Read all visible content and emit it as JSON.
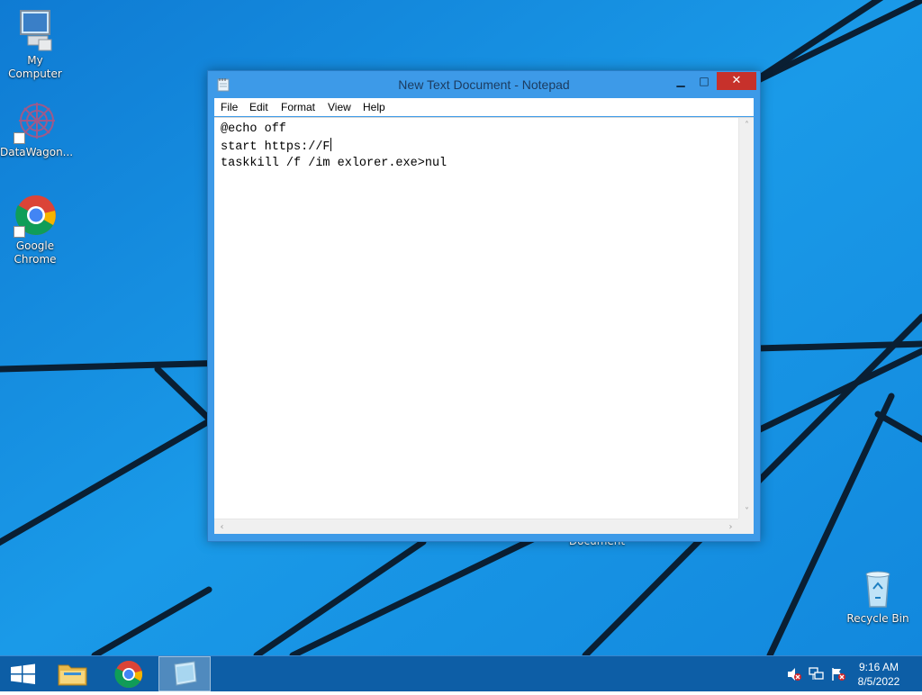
{
  "desktop": {
    "icons": [
      {
        "label": "My Computer",
        "icon": "computer-icon"
      },
      {
        "label": "DataWagon...",
        "icon": "datawagon-icon"
      },
      {
        "label": "Google Chrome",
        "icon": "chrome-icon"
      },
      {
        "label": "Recycle Bin",
        "icon": "recycle-bin-icon"
      }
    ],
    "partially_hidden_label": "Document"
  },
  "notepad": {
    "title": "New Text Document - Notepad",
    "menu": [
      "File",
      "Edit",
      "Format",
      "View",
      "Help"
    ],
    "lines": [
      "@echo off",
      "start https://F",
      "taskkill /f /im exlorer.exe>nul"
    ],
    "controls": {
      "minimize": "▁",
      "maximize": "□",
      "close": "✕"
    }
  },
  "taskbar": {
    "apps": [
      "file-explorer-icon",
      "chrome-icon",
      "notepad-icon"
    ],
    "active_app": "notepad-icon",
    "tray": [
      "volume-muted-icon",
      "network-icon",
      "action-center-icon"
    ],
    "time": "9:16 AM",
    "date": "8/5/2022"
  },
  "colors": {
    "desktop_background": "#1585d8",
    "taskbar": "#0d5ea6",
    "close_button": "#c7312b"
  }
}
